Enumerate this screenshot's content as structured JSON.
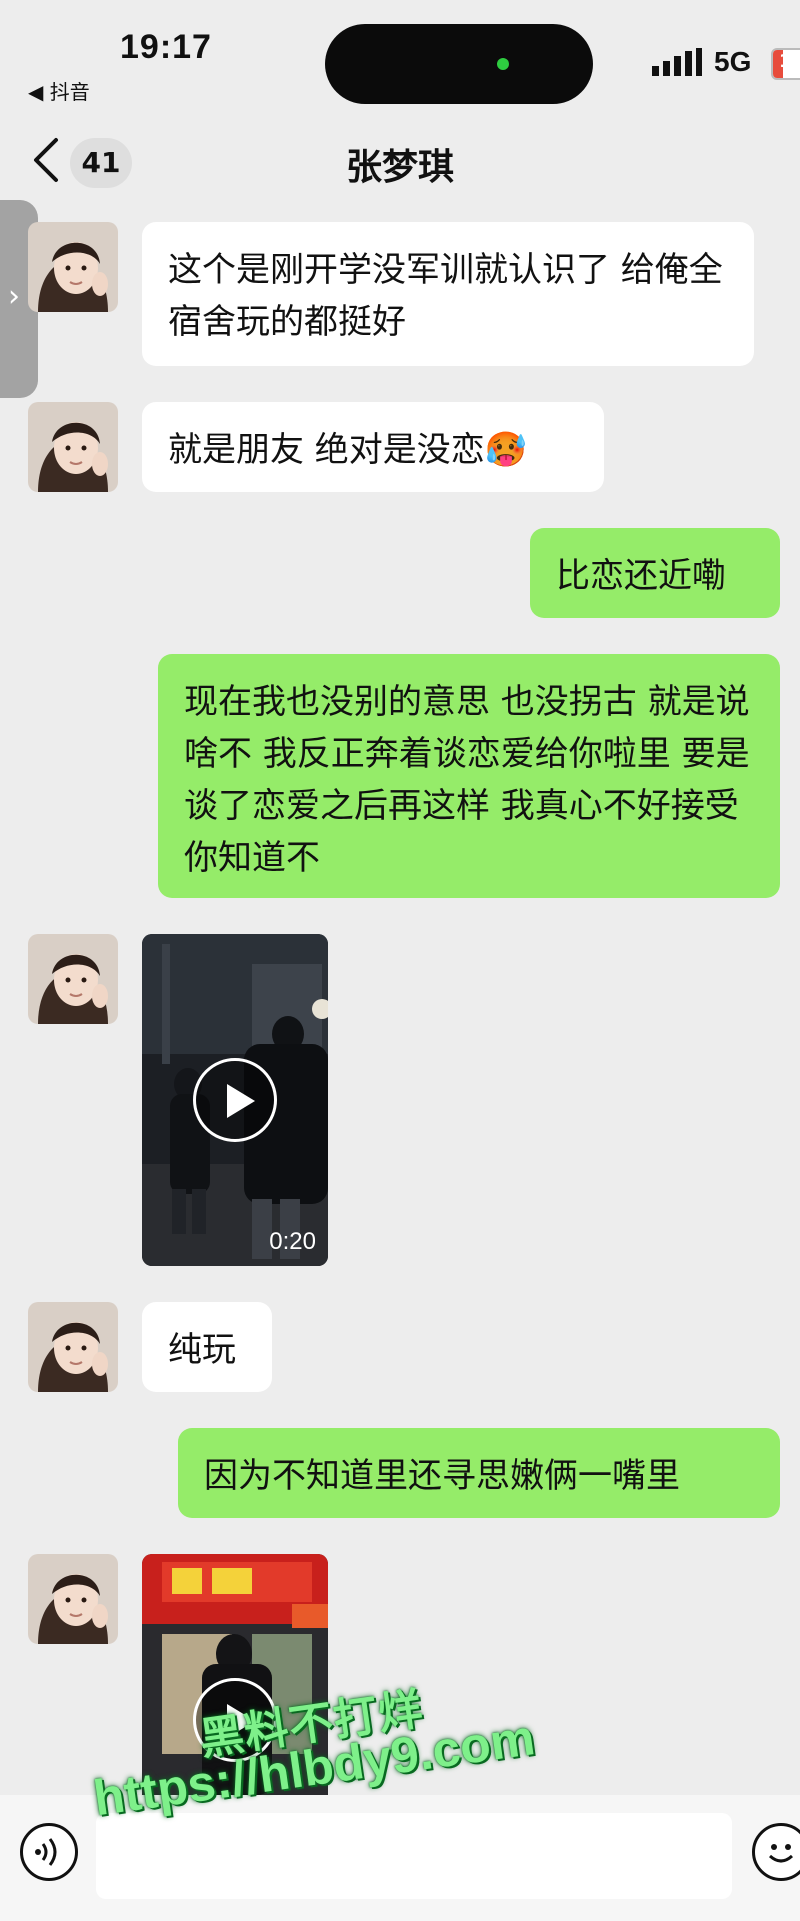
{
  "status_bar": {
    "time": "19:17",
    "back_app": "◀ 抖音",
    "network": "5G",
    "battery": "1"
  },
  "nav": {
    "back_icon": "chevron-left-icon",
    "unread_count": "41",
    "title": "张梦琪"
  },
  "messages": [
    {
      "direction": "in",
      "type": "text",
      "text": "这个是刚开学没军训就认识了 给俺全宿舍玩的都挺好"
    },
    {
      "direction": "in",
      "type": "text",
      "text": "就是朋友 绝对是没恋🥵"
    },
    {
      "direction": "out",
      "type": "text",
      "text": "比恋还近嘞"
    },
    {
      "direction": "out",
      "type": "text",
      "text": "现在我也没别的意思 也没拐古 就是说啥不 我反正奔着谈恋爱给你啦里 要是谈了恋爱之后再这样 我真心不好接受你知道不"
    },
    {
      "direction": "in",
      "type": "video",
      "duration": "0:20"
    },
    {
      "direction": "in",
      "type": "text",
      "text": "纯玩"
    },
    {
      "direction": "out",
      "type": "text",
      "text": "因为不知道里还寻思嫩俩一嘴里"
    },
    {
      "direction": "in",
      "type": "video",
      "duration": ""
    }
  ],
  "input_bar": {
    "voice_icon": "voice-icon",
    "emoji_icon": "emoji-icon",
    "placeholder": ""
  },
  "watermark": {
    "line1": "黑料不打烊",
    "line2": "https://hlbdy9.com"
  },
  "colors": {
    "background": "#ededed",
    "outgoing_bubble": "#95ec69",
    "incoming_bubble": "#ffffff",
    "watermark_fill": "#7ef08a",
    "watermark_outline": "#0a6b22"
  }
}
